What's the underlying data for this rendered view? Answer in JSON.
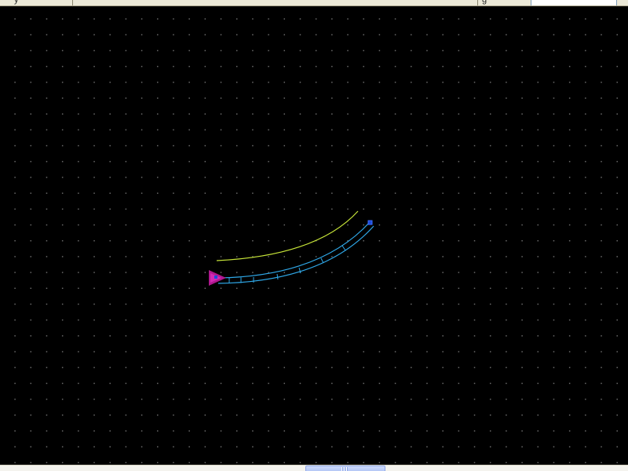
{
  "toolbar": {
    "fragment_left": "y",
    "fragment_mid": "",
    "fragment_right": "g",
    "field_value": ""
  },
  "viewport": {
    "background": "#000000",
    "grid_color": "#6a6a6a",
    "show_grid": true
  },
  "track": {
    "centerline_color": "#c8e639",
    "rail_color": "#2fa8e8",
    "node_color": "#1e4bd8",
    "start_marker_color": "#b0178f"
  },
  "scrollbar": {
    "orientation": "horizontal"
  }
}
